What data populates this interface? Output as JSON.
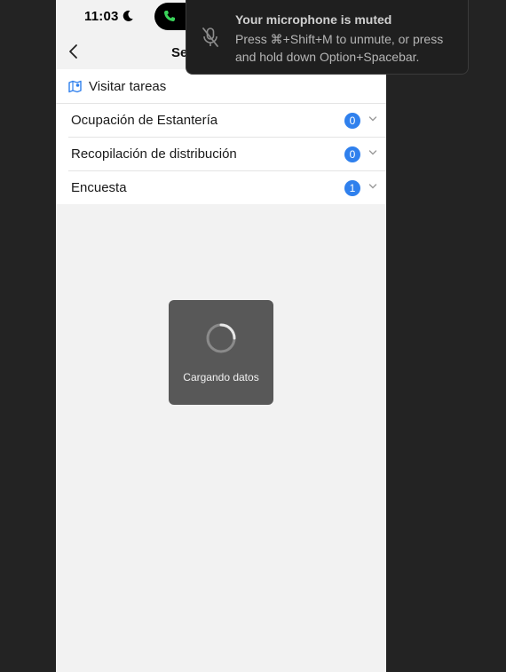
{
  "status_bar": {
    "time": "11:03"
  },
  "nav": {
    "title": "Se"
  },
  "tasks": {
    "header": "Visitar tareas",
    "rows": [
      {
        "label": "Ocupación de Estantería",
        "count": "0"
      },
      {
        "label": "Recopilación de distribución",
        "count": "0"
      },
      {
        "label": "Encuesta",
        "count": "1"
      }
    ]
  },
  "loading": {
    "text": "Cargando datos"
  },
  "notification": {
    "title": "Your microphone is muted",
    "body": "Press ⌘+Shift+M to unmute, or press and hold down Option+Spacebar."
  },
  "colors": {
    "badge": "#2f80ed",
    "call_icon": "#3ad35a",
    "background": "#232323"
  },
  "icons": [
    "moon-icon",
    "phone-call-icon",
    "back-icon",
    "map-icon",
    "chevron-down-icon",
    "spinner-icon",
    "mic-muted-icon"
  ]
}
